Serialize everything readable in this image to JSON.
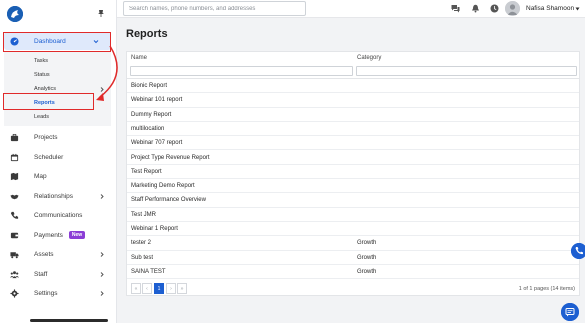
{
  "colors": {
    "accent": "#1d5fd1",
    "active_bg": "#dfe9fb",
    "highlight_box": "#e02a2a",
    "new_badge": "#8b3dd6"
  },
  "sidebar": {
    "logo": "logo-icon",
    "pin": "pin-icon",
    "items": [
      {
        "label": "Dashboard",
        "icon": "dashboard-icon",
        "expanded": true
      },
      {
        "label": "Projects",
        "icon": "briefcase-icon"
      },
      {
        "label": "Scheduler",
        "icon": "calendar-icon"
      },
      {
        "label": "Map",
        "icon": "map-icon"
      },
      {
        "label": "Relationships",
        "icon": "handshake-icon",
        "has_children": true
      },
      {
        "label": "Communications",
        "icon": "phone-icon"
      },
      {
        "label": "Payments",
        "icon": "wallet-icon",
        "badge": "New"
      },
      {
        "label": "Assets",
        "icon": "truck-icon",
        "has_children": true
      },
      {
        "label": "Staff",
        "icon": "users-icon",
        "has_children": true
      },
      {
        "label": "Settings",
        "icon": "gear-icon",
        "has_children": true
      }
    ],
    "dashboard_sub": [
      {
        "label": "Tasks"
      },
      {
        "label": "Status"
      },
      {
        "label": "Analytics",
        "has_children": true
      },
      {
        "label": "Reports",
        "selected": true
      },
      {
        "label": "Leads"
      }
    ]
  },
  "topbar": {
    "search_placeholder": "Search names, phone numbers, and addresses",
    "user_name": "Nafisa Shamoon"
  },
  "main": {
    "title": "Reports",
    "columns": [
      "Name",
      "Category"
    ],
    "rows": [
      {
        "name": "Bionic Report",
        "category": ""
      },
      {
        "name": "Webinar 101 report",
        "category": ""
      },
      {
        "name": "Dummy Report",
        "category": ""
      },
      {
        "name": "multilocation",
        "category": ""
      },
      {
        "name": "Webinar 707 report",
        "category": ""
      },
      {
        "name": "Project Type Revenue Report",
        "category": ""
      },
      {
        "name": "Test Report",
        "category": ""
      },
      {
        "name": "Marketing Demo Report",
        "category": ""
      },
      {
        "name": "Staff Performance Overview",
        "category": ""
      },
      {
        "name": "Test JMR",
        "category": ""
      },
      {
        "name": "Webinar 1 Report",
        "category": ""
      },
      {
        "name": "tester 2",
        "category": "Growth"
      },
      {
        "name": "Sub test",
        "category": "Growth"
      },
      {
        "name": "SAINA TEST",
        "category": "Growth"
      }
    ],
    "pager": {
      "first": "«",
      "prev": "‹",
      "current": "1",
      "next": "›",
      "last": "»",
      "info": "1 of 1 pages (14 items)"
    }
  }
}
